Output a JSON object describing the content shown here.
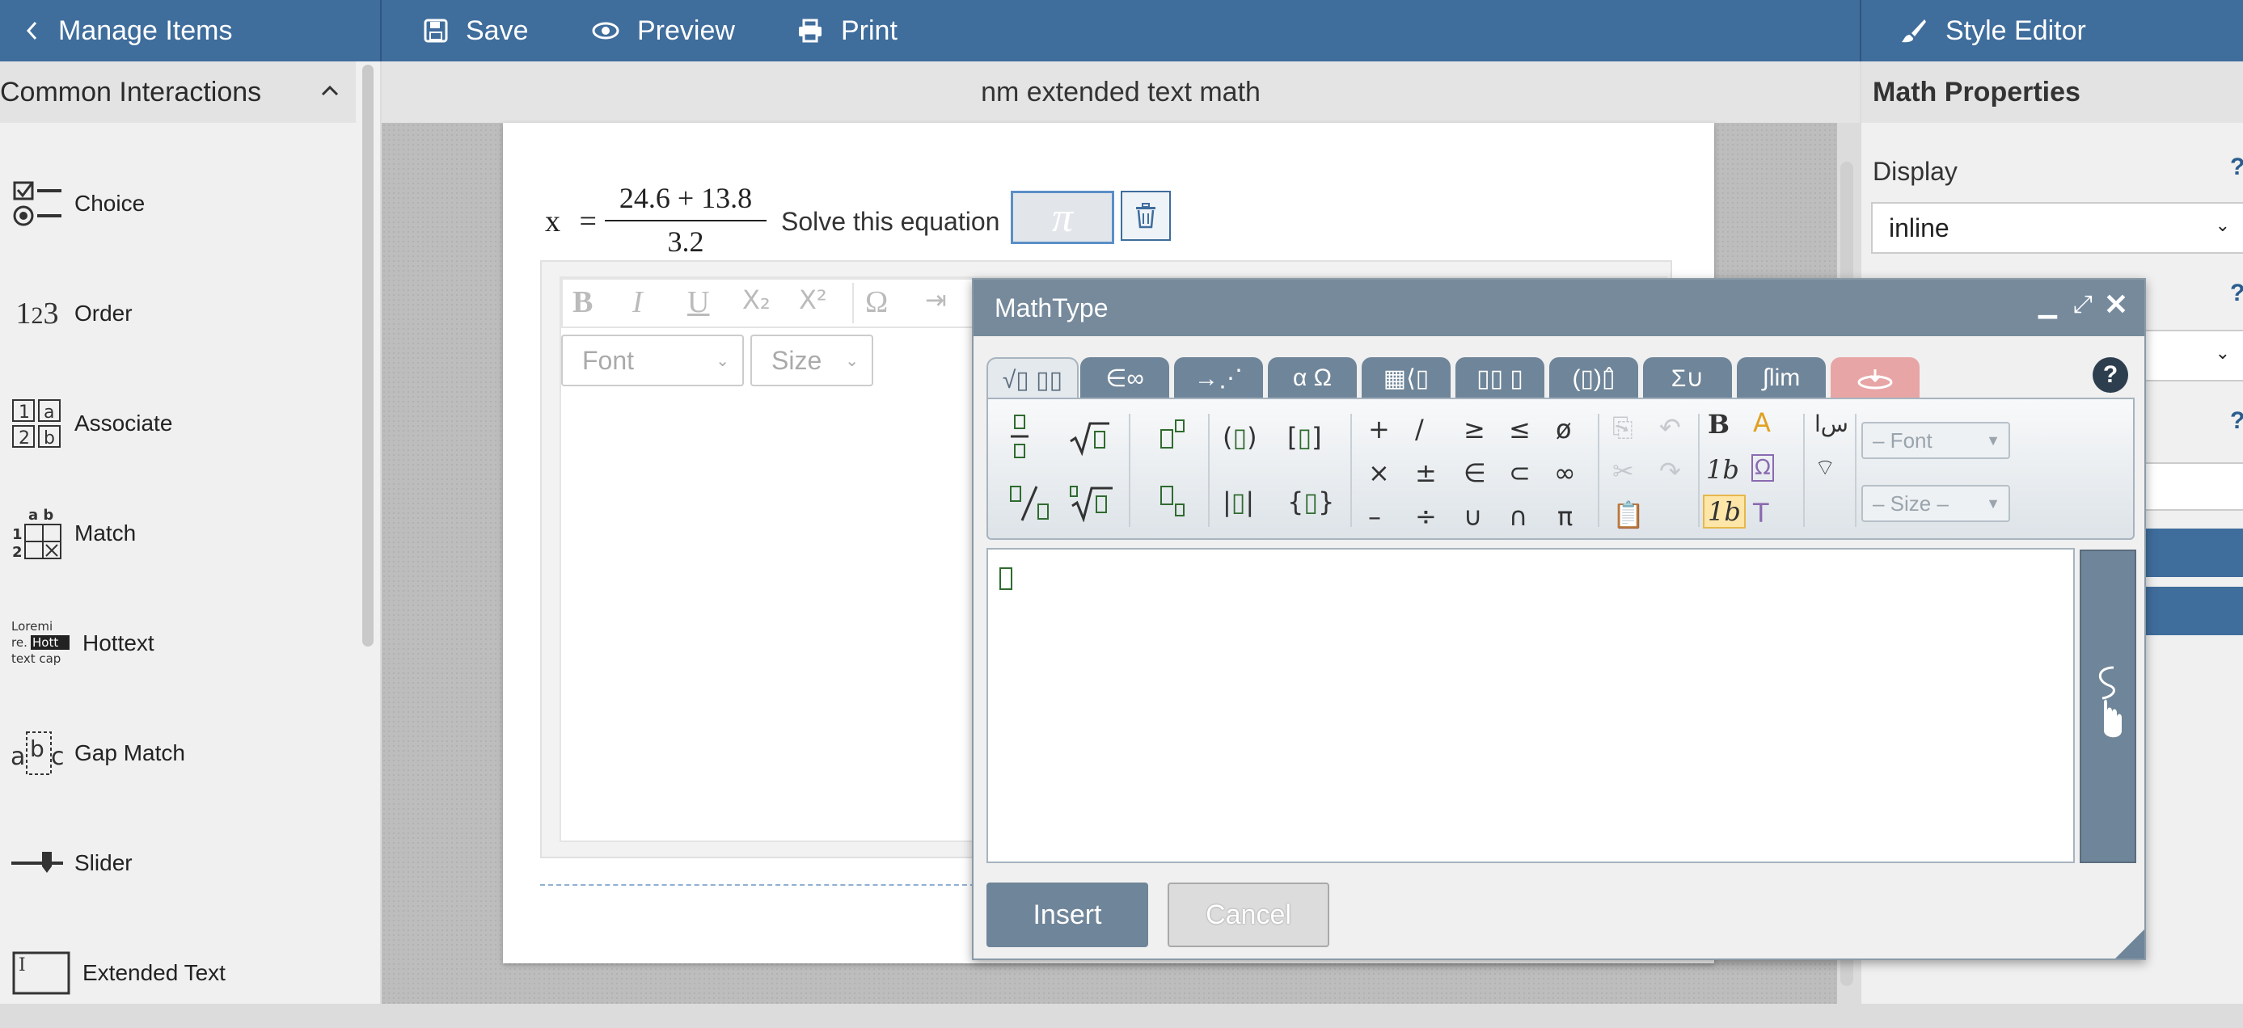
{
  "topbar": {
    "manage_items": "Manage Items",
    "save": "Save",
    "preview": "Preview",
    "print": "Print",
    "style_editor": "Style Editor"
  },
  "left_panel": {
    "header": "Common Interactions",
    "items": [
      {
        "label": "Choice",
        "icon": "choice-icon"
      },
      {
        "label": "Order",
        "icon": "order-icon"
      },
      {
        "label": "Associate",
        "icon": "associate-icon"
      },
      {
        "label": "Match",
        "icon": "match-icon"
      },
      {
        "label": "Hottext",
        "icon": "hottext-icon"
      },
      {
        "label": "Gap Match",
        "icon": "gap-match-icon"
      },
      {
        "label": "Slider",
        "icon": "slider-icon"
      },
      {
        "label": "Extended Text",
        "icon": "extended-text-icon"
      }
    ]
  },
  "center": {
    "title": "nm extended text math",
    "equation": {
      "lhs": "x",
      "eq": "=",
      "numerator": "24.6 + 13.8",
      "denominator": "3.2"
    },
    "prompt": "Solve this equation",
    "math_placeholder": "π"
  },
  "editor_toolbar": {
    "buttons": [
      "B",
      "I",
      "U",
      "X₂",
      "X²",
      "Ω",
      "⇥"
    ],
    "font_select": "Font",
    "size_select": "Size"
  },
  "right_panel": {
    "header": "Math Properties",
    "display_label": "Display",
    "display_value": "inline",
    "help": "?"
  },
  "mathtype": {
    "title": "MathType",
    "tabs": [
      "√▯ ▯▯",
      "∈∞",
      "→⋰",
      "α Ω",
      "▦⟨▯",
      "▯▯ ▯",
      "(▯)▯̂",
      "Σ∪",
      "∫lim",
      ""
    ],
    "help": "?",
    "font_select": "– Font",
    "size_select": "– Size –",
    "insert": "Insert",
    "cancel": "Cancel",
    "ops": {
      "plus": "+",
      "slash": "/",
      "geq": "≥",
      "leq": "≤",
      "empty": "ø",
      "times": "×",
      "pm": "±",
      "in": "∈",
      "subset": "⊂",
      "infty": "∞",
      "minus": "–",
      "div": "÷",
      "cup": "∪",
      "cap": "∩",
      "pi": "π"
    },
    "style_sym": {
      "bold": "B",
      "italic": "1b",
      "italic2": "1b",
      "text": "T"
    }
  },
  "colors": {
    "topbar": "#3f6d9c",
    "dialog_header": "#768a9c",
    "accent": "#2a5d8f"
  }
}
